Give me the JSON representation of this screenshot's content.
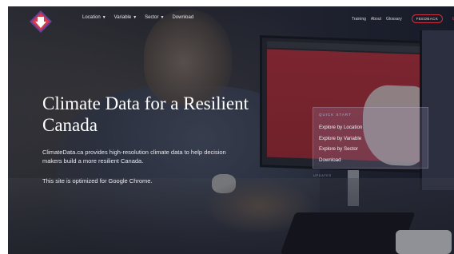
{
  "nav": {
    "left_items": [
      {
        "label": "Location",
        "has_dropdown": true
      },
      {
        "label": "Variable",
        "has_dropdown": true
      },
      {
        "label": "Sector",
        "has_dropdown": true
      },
      {
        "label": "Download",
        "has_dropdown": false
      }
    ],
    "right_items": [
      "Training",
      "About",
      "Glossary"
    ],
    "feedback_label": "FEEDBACK",
    "language_label": "EN"
  },
  "hero": {
    "title": "Climate Data for a Resilient Canada",
    "description": "ClimateData.ca provides high-resolution climate data to help decision makers build a more resilient Canada.",
    "note": "This site is optimized for Google Chrome."
  },
  "quick_start": {
    "title": "QUICK START",
    "items": [
      "Explore by Location",
      "Explore by Variable",
      "Explore by Sector",
      "Download"
    ]
  },
  "updates_label": "UPDATES",
  "colors": {
    "accent": "#d63a48",
    "logo_purple": "#6b3f9a",
    "logo_red": "#d63a48",
    "text_light": "#ffffff"
  }
}
